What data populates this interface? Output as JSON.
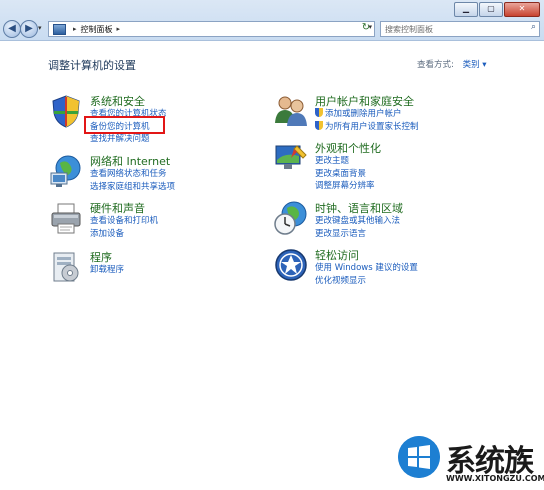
{
  "window": {
    "minimize_label": "▁",
    "maximize_label": "▢",
    "close_label": "✕"
  },
  "addressbar": {
    "crumbs": [
      "控制面板"
    ],
    "separator": "▸",
    "search_placeholder": "搜索控制面板"
  },
  "page": {
    "title": "调整计算机的设置",
    "view_by_label": "查看方式:",
    "view_by_value": "类别 ▾"
  },
  "categories": [
    {
      "title": "系统和安全",
      "icon": "shield-flag-icon",
      "links": [
        "查看您的计算机状态",
        "备份您的计算机",
        "查找并解决问题"
      ]
    },
    {
      "title": "网络和 Internet",
      "icon": "network-globe-icon",
      "links": [
        "查看网络状态和任务",
        "选择家庭组和共享选项"
      ]
    },
    {
      "title": "硬件和声音",
      "icon": "printer-icon",
      "links": [
        "查看设备和打印机",
        "添加设备"
      ]
    },
    {
      "title": "程序",
      "icon": "programs-icon",
      "links": [
        "卸载程序"
      ]
    },
    {
      "title": "用户帐户和家庭安全",
      "icon": "users-icon",
      "links": [
        "添加或删除用户帐户",
        "为所有用户设置家长控制"
      ]
    },
    {
      "title": "外观和个性化",
      "icon": "monitor-paint-icon",
      "links": [
        "更改主题",
        "更改桌面背景",
        "调整屏幕分辨率"
      ]
    },
    {
      "title": "时钟、语言和区域",
      "icon": "clock-globe-icon",
      "links": [
        "更改键盘或其他输入法",
        "更改显示语言"
      ]
    },
    {
      "title": "轻松访问",
      "icon": "ease-of-access-icon",
      "links": [
        "使用 Windows 建议的设置",
        "优化视频显示"
      ]
    }
  ],
  "watermark": {
    "brand": "系统族",
    "url": "WWW.XITONGZU.COM"
  },
  "colors": {
    "link": "#1c5dbd",
    "category_title": "#1f6b1f",
    "highlight": "#e21616"
  }
}
